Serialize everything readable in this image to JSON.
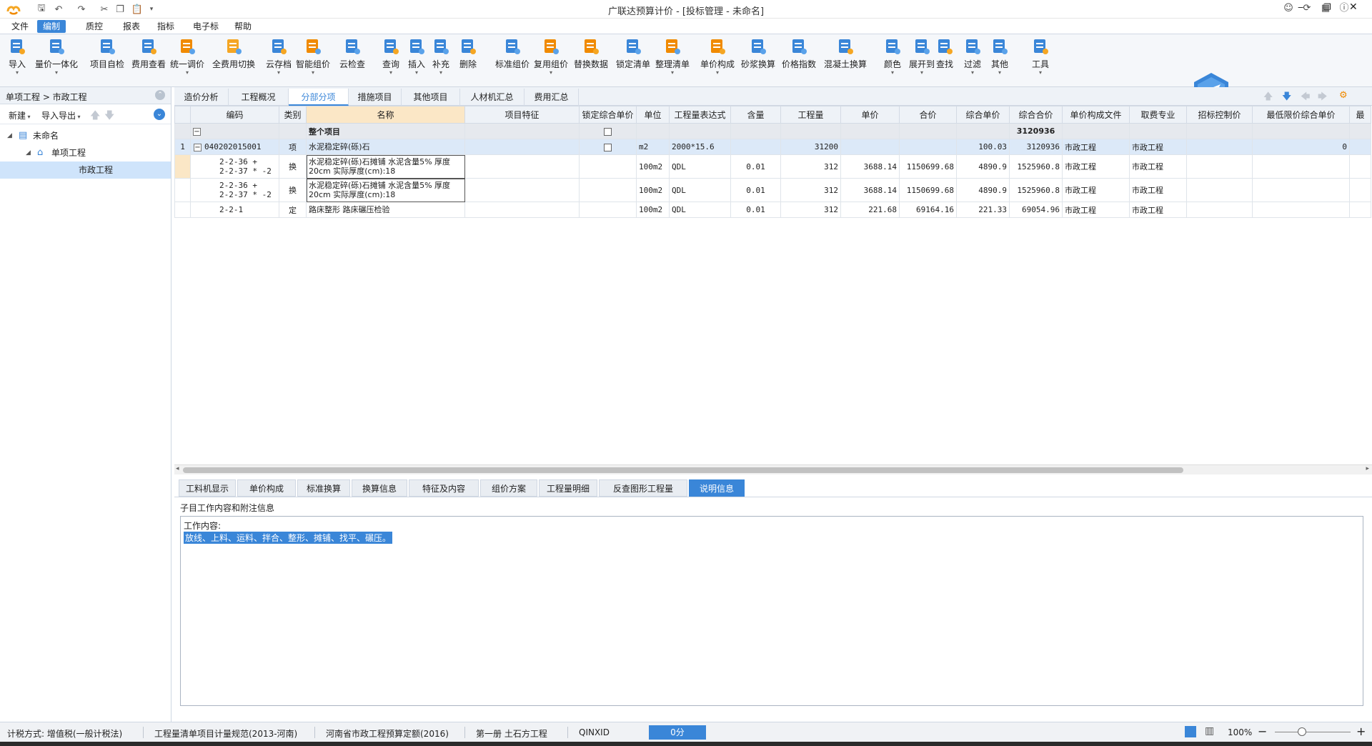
{
  "window": {
    "title": "广联达预算计价 - [投标管理 - 未命名]"
  },
  "menu": [
    "文件",
    "编制",
    "质控",
    "报表",
    "指标",
    "电子标",
    "帮助"
  ],
  "menu_active": 1,
  "ribbon": [
    {
      "label": "导入",
      "icon": "import-icon",
      "arrow": true
    },
    {
      "label": "量价一体化",
      "icon": "quantity-price-icon",
      "arrow": true
    },
    {
      "label": "项目自检",
      "icon": "self-check-icon",
      "arrow": false
    },
    {
      "label": "费用查看",
      "icon": "cost-view-icon",
      "arrow": false
    },
    {
      "label": "统一调价",
      "icon": "unify-price-icon",
      "arrow": true
    },
    {
      "label": "全费用切换",
      "icon": "full-cost-switch-icon",
      "arrow": false
    },
    {
      "label": "云存档",
      "icon": "cloud-archive-icon",
      "arrow": true
    },
    {
      "label": "智能组价",
      "icon": "smart-pricing-icon",
      "arrow": true
    },
    {
      "label": "云检查",
      "icon": "cloud-check-icon",
      "arrow": false
    },
    {
      "label": "查询",
      "icon": "query-icon",
      "arrow": true
    },
    {
      "label": "插入",
      "icon": "insert-icon",
      "arrow": true
    },
    {
      "label": "补充",
      "icon": "supplement-icon",
      "arrow": true
    },
    {
      "label": "删除",
      "icon": "delete-icon",
      "arrow": false
    },
    {
      "label": "标准组价",
      "icon": "standard-pricing-icon",
      "arrow": false
    },
    {
      "label": "复用组价",
      "icon": "reuse-pricing-icon",
      "arrow": true
    },
    {
      "label": "替换数据",
      "icon": "replace-data-icon",
      "arrow": false
    },
    {
      "label": "锁定清单",
      "icon": "lock-list-icon",
      "arrow": false
    },
    {
      "label": "整理清单",
      "icon": "organize-list-icon",
      "arrow": true
    },
    {
      "label": "单价构成",
      "icon": "unit-price-composition-icon",
      "arrow": true
    },
    {
      "label": "砂浆换算",
      "icon": "mortar-conversion-icon",
      "arrow": false
    },
    {
      "label": "价格指数",
      "icon": "price-index-icon",
      "arrow": false
    },
    {
      "label": "混凝土换算",
      "icon": "concrete-conversion-icon",
      "arrow": false
    },
    {
      "label": "颜色",
      "icon": "color-icon",
      "arrow": true
    },
    {
      "label": "展开到",
      "icon": "expand-to-icon",
      "arrow": true
    },
    {
      "label": "查找",
      "icon": "find-icon",
      "arrow": false
    },
    {
      "label": "过滤",
      "icon": "filter-icon",
      "arrow": true
    },
    {
      "label": "其他",
      "icon": "other-icon",
      "arrow": true
    },
    {
      "label": "工具",
      "icon": "tools-icon",
      "arrow": true
    }
  ],
  "left_panel": {
    "breadcrumb": "单项工程 > 市政工程",
    "new_label": "新建",
    "import_export_label": "导入导出",
    "tree": [
      {
        "label": "未命名",
        "level": 0,
        "icon": "building-icon"
      },
      {
        "label": "单项工程",
        "level": 1,
        "icon": "home-icon"
      },
      {
        "label": "市政工程",
        "level": 2,
        "icon": ""
      }
    ]
  },
  "top_tabs": [
    "造价分析",
    "工程概况",
    "分部分项",
    "措施项目",
    "其他项目",
    "人材机汇总",
    "费用汇总"
  ],
  "top_tab_active": 2,
  "grid": {
    "columns": [
      "编码",
      "类别",
      "名称",
      "项目特征",
      "锁定综合单价",
      "单位",
      "工程量表达式",
      "含量",
      "工程量",
      "单价",
      "合价",
      "综合单价",
      "综合合价",
      "单价构成文件",
      "取费专业",
      "招标控制价",
      "最低限价综合单价",
      "最"
    ],
    "group_row": {
      "name": "整个项目",
      "total": "3120936"
    },
    "rows": [
      {
        "no": "1",
        "code": "040202015001",
        "type": "项",
        "name": "水泥稳定碎(砾)石",
        "unit": "m2",
        "expr": "2000*15.6",
        "content": "",
        "qty": "31200",
        "price": "",
        "amount": "",
        "comp_price": "100.03",
        "comp_amount": "3120936",
        "file": "市政工程",
        "spec": "市政工程",
        "ctrl": "",
        "min": "0"
      },
      {
        "no": "",
        "code": "2-2-36 +\n2-2-37 * -2",
        "type": "换",
        "name": "水泥稳定碎(砾)石摊铺 水泥含量5% 厚度20cm  实际厚度(cm):18",
        "unit": "100m2",
        "expr": "QDL",
        "content": "0.01",
        "qty": "312",
        "price": "3688.14",
        "amount": "1150699.68",
        "comp_price": "4890.9",
        "comp_amount": "1525960.8",
        "file": "市政工程",
        "spec": "市政工程",
        "ctrl": "",
        "min": ""
      },
      {
        "no": "",
        "code": "2-2-36 +\n2-2-37 * -2",
        "type": "换",
        "name": "水泥稳定碎(砾)石摊铺 水泥含量5% 厚度20cm  实际厚度(cm):18",
        "unit": "100m2",
        "expr": "QDL",
        "content": "0.01",
        "qty": "312",
        "price": "3688.14",
        "amount": "1150699.68",
        "comp_price": "4890.9",
        "comp_amount": "1525960.8",
        "file": "市政工程",
        "spec": "市政工程",
        "ctrl": "",
        "min": ""
      },
      {
        "no": "",
        "code": "2-2-1",
        "type": "定",
        "name": "路床整形 路床碾压检验",
        "unit": "100m2",
        "expr": "QDL",
        "content": "0.01",
        "qty": "312",
        "price": "221.68",
        "amount": "69164.16",
        "comp_price": "221.33",
        "comp_amount": "69054.96",
        "file": "市政工程",
        "spec": "市政工程",
        "ctrl": "",
        "min": ""
      }
    ]
  },
  "bottom_tabs": [
    "工料机显示",
    "单价构成",
    "标准换算",
    "换算信息",
    "特征及内容",
    "组价方案",
    "工程量明细",
    "反查图形工程量",
    "说明信息"
  ],
  "bottom_tab_active": 8,
  "detail": {
    "label": "子目工作内容和附注信息",
    "line1": "工作内容:",
    "line2": "放线、上料、运料、拌合、整形、摊铺、找平、碾压。"
  },
  "status": {
    "tax": "计税方式: 增值税(一般计税法)",
    "standard": "工程量清单项目计量规范(2013-河南)",
    "quota": "河南省市政工程预算定额(2016)",
    "volume": "第一册 土石方工程",
    "user": "QINXID",
    "score": "0分",
    "zoom": "100%"
  },
  "colors": {
    "accent": "#3a86d8",
    "selection": "#dce9f8",
    "header_highlight": "#fbe7c6"
  }
}
